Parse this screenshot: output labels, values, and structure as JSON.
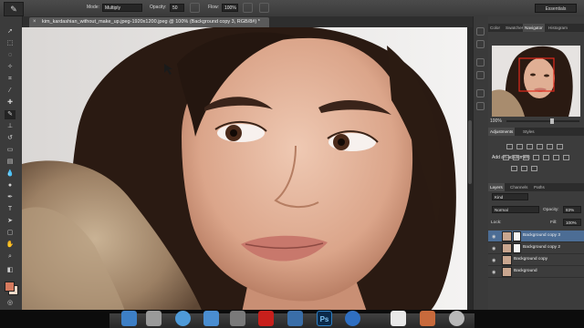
{
  "options_bar": {
    "mode_label": "Mode:",
    "mode_value": "Multiply",
    "opacity_label": "Opacity:",
    "opacity_value": "50",
    "flow_label": "Flow:",
    "flow_value": "100%",
    "workspace": "Essentials"
  },
  "document": {
    "tab_title": "kim_kardashian_without_make_up.jpeg-1920x1200.jpeg @ 100% (Background copy 3, RGB/8#) *",
    "close_glyph": "×"
  },
  "navigator": {
    "tabs": [
      "Color",
      "Swatches",
      "Navigator",
      "Histogram"
    ],
    "active_tab": "Navigator",
    "zoom": "100%"
  },
  "adjustments": {
    "tabs": [
      "Adjustments",
      "Styles"
    ],
    "active_tab": "Adjustments",
    "title": "Add an adjustment"
  },
  "layers": {
    "tabs": [
      "Layers",
      "Channels",
      "Paths"
    ],
    "active_tab": "Layers",
    "filter_label": "Kind",
    "blend_mode": "Normal",
    "opacity_label": "Opacity:",
    "opacity_value": "83%",
    "lock_label": "Lock:",
    "fill_label": "Fill:",
    "fill_value": "100%",
    "items": [
      {
        "name": "Background copy 3",
        "selected": true
      },
      {
        "name": "Background copy 2",
        "selected": false
      },
      {
        "name": "Background copy",
        "selected": false
      },
      {
        "name": "Background",
        "selected": false
      }
    ]
  },
  "dock": {
    "ps_label": "Ps"
  },
  "colors": {
    "selection": "#4c6d95",
    "foreground": "#d67a5e",
    "background": "#f0d9c8"
  }
}
